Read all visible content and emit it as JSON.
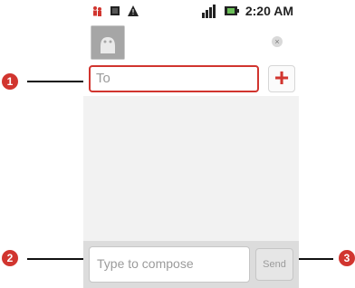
{
  "status_bar": {
    "time": "2:20 AM",
    "icons": [
      "people-icon",
      "sim-icon",
      "alert-icon",
      "signal-icon",
      "battery-icon"
    ]
  },
  "header": {
    "avatar_icon": "android-avatar-icon",
    "close_icon": "close-icon"
  },
  "recipient": {
    "placeholder": "To",
    "add_label": "+"
  },
  "compose": {
    "placeholder": "Type to compose",
    "send_label": "Send"
  },
  "callouts": [
    "1",
    "2",
    "3"
  ],
  "colors": {
    "accent": "#d1352f",
    "callout_line": "#111111"
  }
}
